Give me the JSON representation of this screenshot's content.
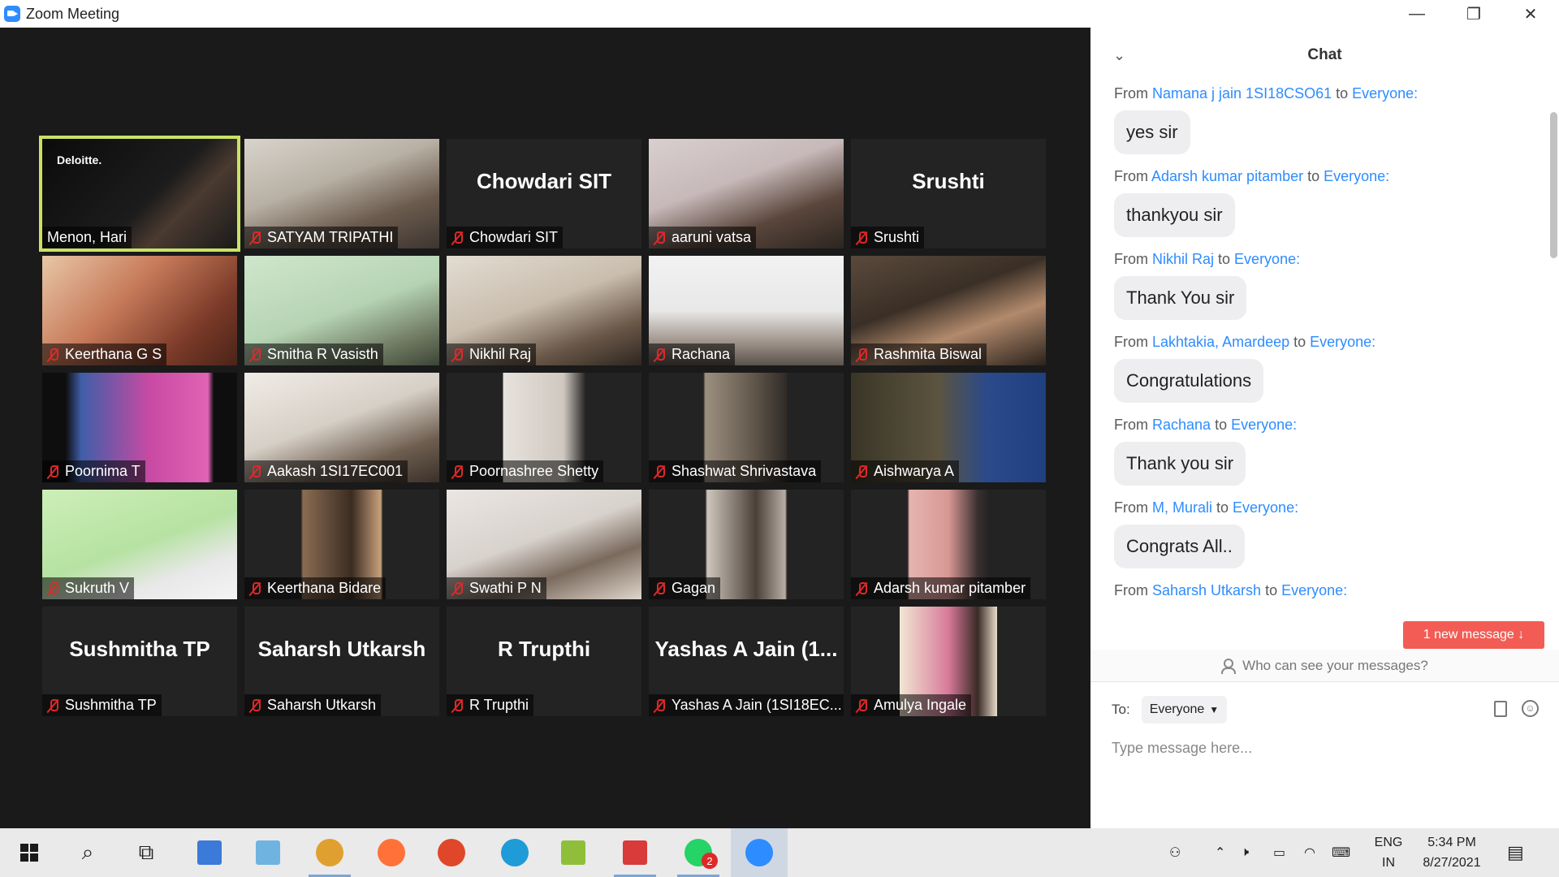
{
  "window": {
    "title": "Zoom Meeting",
    "minimize": "—",
    "restore": "❐",
    "close": "✕"
  },
  "participants": [
    {
      "name": "Menon, Hari",
      "video": "linear-gradient(135deg,#0b0b0b 0%,#1c1c1c 55%,#4a3a30 70%,#1a1a1a 100%)",
      "overlay": "Deloitte.",
      "speaker": true
    },
    {
      "name": "SATYAM TRIPATHI",
      "video": "linear-gradient(160deg,#d8d4cc 0%,#b8b0a4 40%,#6b5b4e 70%,#3d3530 100%)"
    },
    {
      "name": "Chowdari SIT",
      "big": "Chowdari SIT"
    },
    {
      "name": "aaruni vatsa",
      "video": "linear-gradient(160deg,#d9cfcf 0%,#c7b9b9 40%,#5a463c 70%,#2b2520 100%)"
    },
    {
      "name": "Srushti",
      "big": "Srushti"
    },
    {
      "name": "Keerthana G S",
      "video": "linear-gradient(135deg,#e8c7a8 0%,#c77b5a 40%,#7a3a28 75%,#4a2418 100%)"
    },
    {
      "name": "Smitha R Vasisth",
      "video": "linear-gradient(160deg,#cfe6cc 0%,#b6d4b4 50%,#6f7a62 80%,#3c4536 100%)"
    },
    {
      "name": "Nikhil Raj",
      "video": "linear-gradient(160deg,#e3dcd2 0%,#c9bdae 45%,#6a5848 75%,#2e2620 100%)"
    },
    {
      "name": "Rachana",
      "video": "linear-gradient(180deg,#f2f2f2 0%,#e8e8e8 50%,#9b8f86 80%,#5a524c 100%)"
    },
    {
      "name": "Rashmita Biswal",
      "video": "linear-gradient(160deg,#5a4a3c 0%,#3a2f26 40%,#b28a6c 65%,#2a221c 100%)"
    },
    {
      "name": "Poornima T",
      "video": "linear-gradient(90deg,#0e0e0e 0%,#0e0e0e 12%,#3f5ea8 20%,#c84aa3 55%,#e063b5 85%,#0e0e0e 88%,#0e0e0e 100%)"
    },
    {
      "name": "Aakash 1SI17EC001",
      "video": "linear-gradient(160deg,#f0ece6 0%,#d6cfc6 45%,#6e5e50 75%,#3a302a 100%)"
    },
    {
      "name": "Poornashree Shetty",
      "video": "linear-gradient(90deg,#232323 0%,#232323 29%,#e7e2dc 29%,#cfc8c0 60%,#2a2a2a 71%,#232323 71%,#232323 100%)"
    },
    {
      "name": "Shashwat Shrivastava",
      "video": "linear-gradient(90deg,#232323 0%,#232323 28%,#9c9080 29%,#5e5448 55%,#2e2a26 71%,#232323 71%,#232323 100%)"
    },
    {
      "name": "Aishwarya A",
      "video": "linear-gradient(90deg,#3a3526 0%,#5c5440 45%,#2a4a8a 70%,#1f3f80 100%)"
    },
    {
      "name": "Sukruth V",
      "video": "linear-gradient(160deg,#cdeeb8 0%,#b6e2a2 50%,#e8e8e8 75%,#f4f4f4 100%)"
    },
    {
      "name": "Keerthana Bidare",
      "video": "linear-gradient(90deg,#232323 0%,#232323 29%,#8a6c52 30%,#3a2c22 55%,#c9a07c 70%,#232323 71%,#232323 100%)"
    },
    {
      "name": "Swathi P N",
      "video": "linear-gradient(160deg,#eae6e2 0%,#d8d2cc 45%,#7a6a5e 70%,#e0d6cc 100%)"
    },
    {
      "name": "Gagan",
      "video": "linear-gradient(90deg,#232323 0%,#232323 29%,#cfc6bc 30%,#4a4038 55%,#b8aea4 70%,#232323 71%,#232323 100%)"
    },
    {
      "name": "Adarsh kumar pitamber",
      "video": "linear-gradient(90deg,#232323 0%,#232323 29%,#e6b4b0 30%,#d89894 50%,#3a3030 65%,#232323 71%,#232323 100%)"
    },
    {
      "name": "Sushmitha TP",
      "big": "Sushmitha TP"
    },
    {
      "name": "Saharsh Utkarsh",
      "big": "Saharsh Utkarsh"
    },
    {
      "name": "R Trupthi",
      "big": "R Trupthi"
    },
    {
      "name": "Yashas A Jain (1SI18EC...",
      "big": "Yashas A Jain (1..."
    },
    {
      "name": "Amulya Ingale",
      "video": "linear-gradient(90deg,#232323 0%,#232323 25%,#f1e6d2 25%,#d87a9a 50%,#3a2a26 65%,#e8dcc8 75%,#232323 75%,#232323 100%)"
    }
  ],
  "chat": {
    "title": "Chat",
    "collapse_glyph": "⌄",
    "messages": [
      {
        "prefix": "From ",
        "sender": "Namana j jain 1SI18CSO61",
        "to_word": " to ",
        "recipient": "Everyone:",
        "text": "yes sir"
      },
      {
        "prefix": "From ",
        "sender": "Adarsh kumar pitamber",
        "to_word": " to ",
        "recipient": "Everyone:",
        "text": "thankyou sir"
      },
      {
        "prefix": "From ",
        "sender": "Nikhil Raj",
        "to_word": " to ",
        "recipient": "Everyone:",
        "text": "Thank You sir"
      },
      {
        "prefix": "From ",
        "sender": "Lakhtakia, Amardeep",
        "to_word": " to ",
        "recipient": "Everyone:",
        "text": "Congratulations"
      },
      {
        "prefix": "From ",
        "sender": "Rachana",
        "to_word": " to ",
        "recipient": "Everyone:",
        "text": "Thank you sir"
      },
      {
        "prefix": "From ",
        "sender": "M, Murali",
        "to_word": " to ",
        "recipient": "Everyone:",
        "text": "Congrats All.."
      },
      {
        "prefix": "From ",
        "sender": "Saharsh Utkarsh",
        "to_word": " to ",
        "recipient": "Everyone:",
        "text": ""
      }
    ],
    "new_message": "1 new message ↓",
    "privacy_link": "Who can see your messages?",
    "to_label": "To:",
    "to_value": "Everyone",
    "input_placeholder": "Type message here..."
  },
  "taskbar": {
    "apps": [
      {
        "id": "search",
        "glyph": "⌕"
      },
      {
        "id": "task-view",
        "glyph": "⧉"
      },
      {
        "id": "computer",
        "color": "#3b7ad9"
      },
      {
        "id": "notebook",
        "color": "#6fb4e0"
      },
      {
        "id": "chrome",
        "color": "#e0a030",
        "open": true
      },
      {
        "id": "firefox",
        "color": "#ff7139"
      },
      {
        "id": "proxy",
        "color": "#e0472a"
      },
      {
        "id": "edge",
        "color": "#1f9bd8"
      },
      {
        "id": "notepad-plus",
        "color": "#8fbf3a"
      },
      {
        "id": "store",
        "color": "#d93a3a",
        "open": true
      },
      {
        "id": "whatsapp",
        "color": "#25d366",
        "badge": "2",
        "open": true
      },
      {
        "id": "zoom",
        "color": "#2d8cff",
        "active": true
      }
    ],
    "language": "ENG",
    "region": "IN",
    "time": "5:34 PM",
    "date": "8/27/2021"
  }
}
